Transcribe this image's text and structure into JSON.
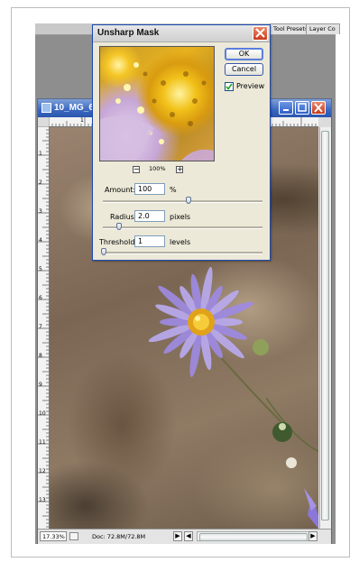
{
  "panel_tabs": [
    "Tool Presets",
    "Layer Co"
  ],
  "document": {
    "title": "10_MG_6",
    "ruler_top_labels": [
      "1"
    ],
    "ruler_left_labels": [
      "1",
      "2",
      "3",
      "4",
      "5",
      "6",
      "7",
      "8",
      "9",
      "10",
      "11",
      "12",
      "13"
    ],
    "status": {
      "zoom": "17.33%",
      "doc_size": "Doc: 72.8M/72.8M",
      "next_arrow": "▶",
      "scroll_left": "◀",
      "scroll_right": "▶"
    }
  },
  "dialog": {
    "title": "Unsharp Mask",
    "ok_label": "OK",
    "cancel_label": "Cancel",
    "preview_label": "Preview",
    "preview_checked": true,
    "zoom_out": "−",
    "zoom_in": "+",
    "zoom_level": "100%",
    "amount": {
      "label": "Amount:",
      "value": "100",
      "unit": "%",
      "slider_fraction": 0.55
    },
    "radius": {
      "label": "Radius:",
      "value": "2.0",
      "unit": "pixels",
      "slider_fraction": 0.1
    },
    "threshold": {
      "label": "Threshold:",
      "value": "1",
      "unit": "levels",
      "slider_fraction": 0.0
    }
  },
  "colors": {
    "title_bar_blue": "#3a67c0",
    "close_red": "#c93a1b",
    "dialog_face": "#ece9d8"
  }
}
